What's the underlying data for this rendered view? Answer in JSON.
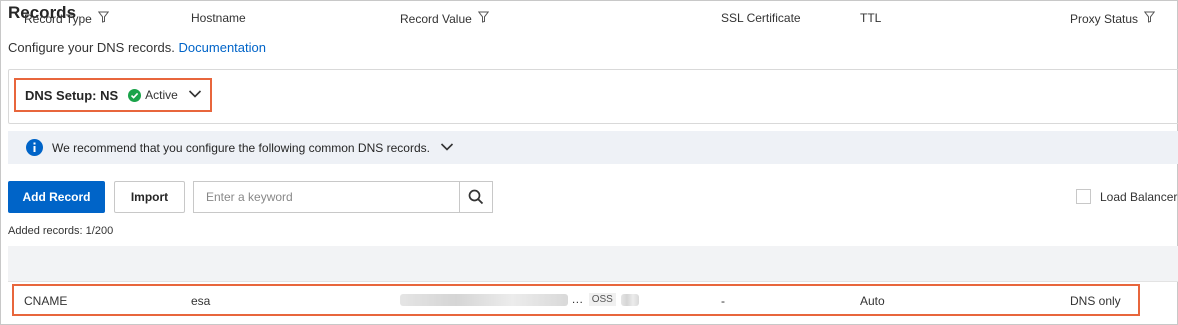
{
  "page": {
    "title": "Records",
    "subtitle": "Configure your DNS records.",
    "doc_link": "Documentation"
  },
  "dns_setup": {
    "label": "DNS Setup: NS",
    "status": "Active",
    "status_color": "#1aa34a"
  },
  "banner": {
    "text": "We recommend that you configure the following common DNS records."
  },
  "toolbar": {
    "add_label": "Add Record",
    "import_label": "Import",
    "search_placeholder": "Enter a keyword",
    "load_balancer_label": "Load Balancer"
  },
  "records_count": "Added records: 1/200",
  "table": {
    "columns": [
      "Record Type",
      "Hostname",
      "Record Value",
      "SSL Certificate",
      "TTL",
      "Proxy Status"
    ],
    "rows": [
      {
        "record_type": "CNAME",
        "hostname": "esa",
        "record_value_tag": "OSS",
        "ssl_certificate": "-",
        "ttl": "Auto",
        "proxy_status": "DNS only"
      }
    ]
  },
  "colors": {
    "primary": "#0064c8",
    "highlight": "#e8663c"
  }
}
